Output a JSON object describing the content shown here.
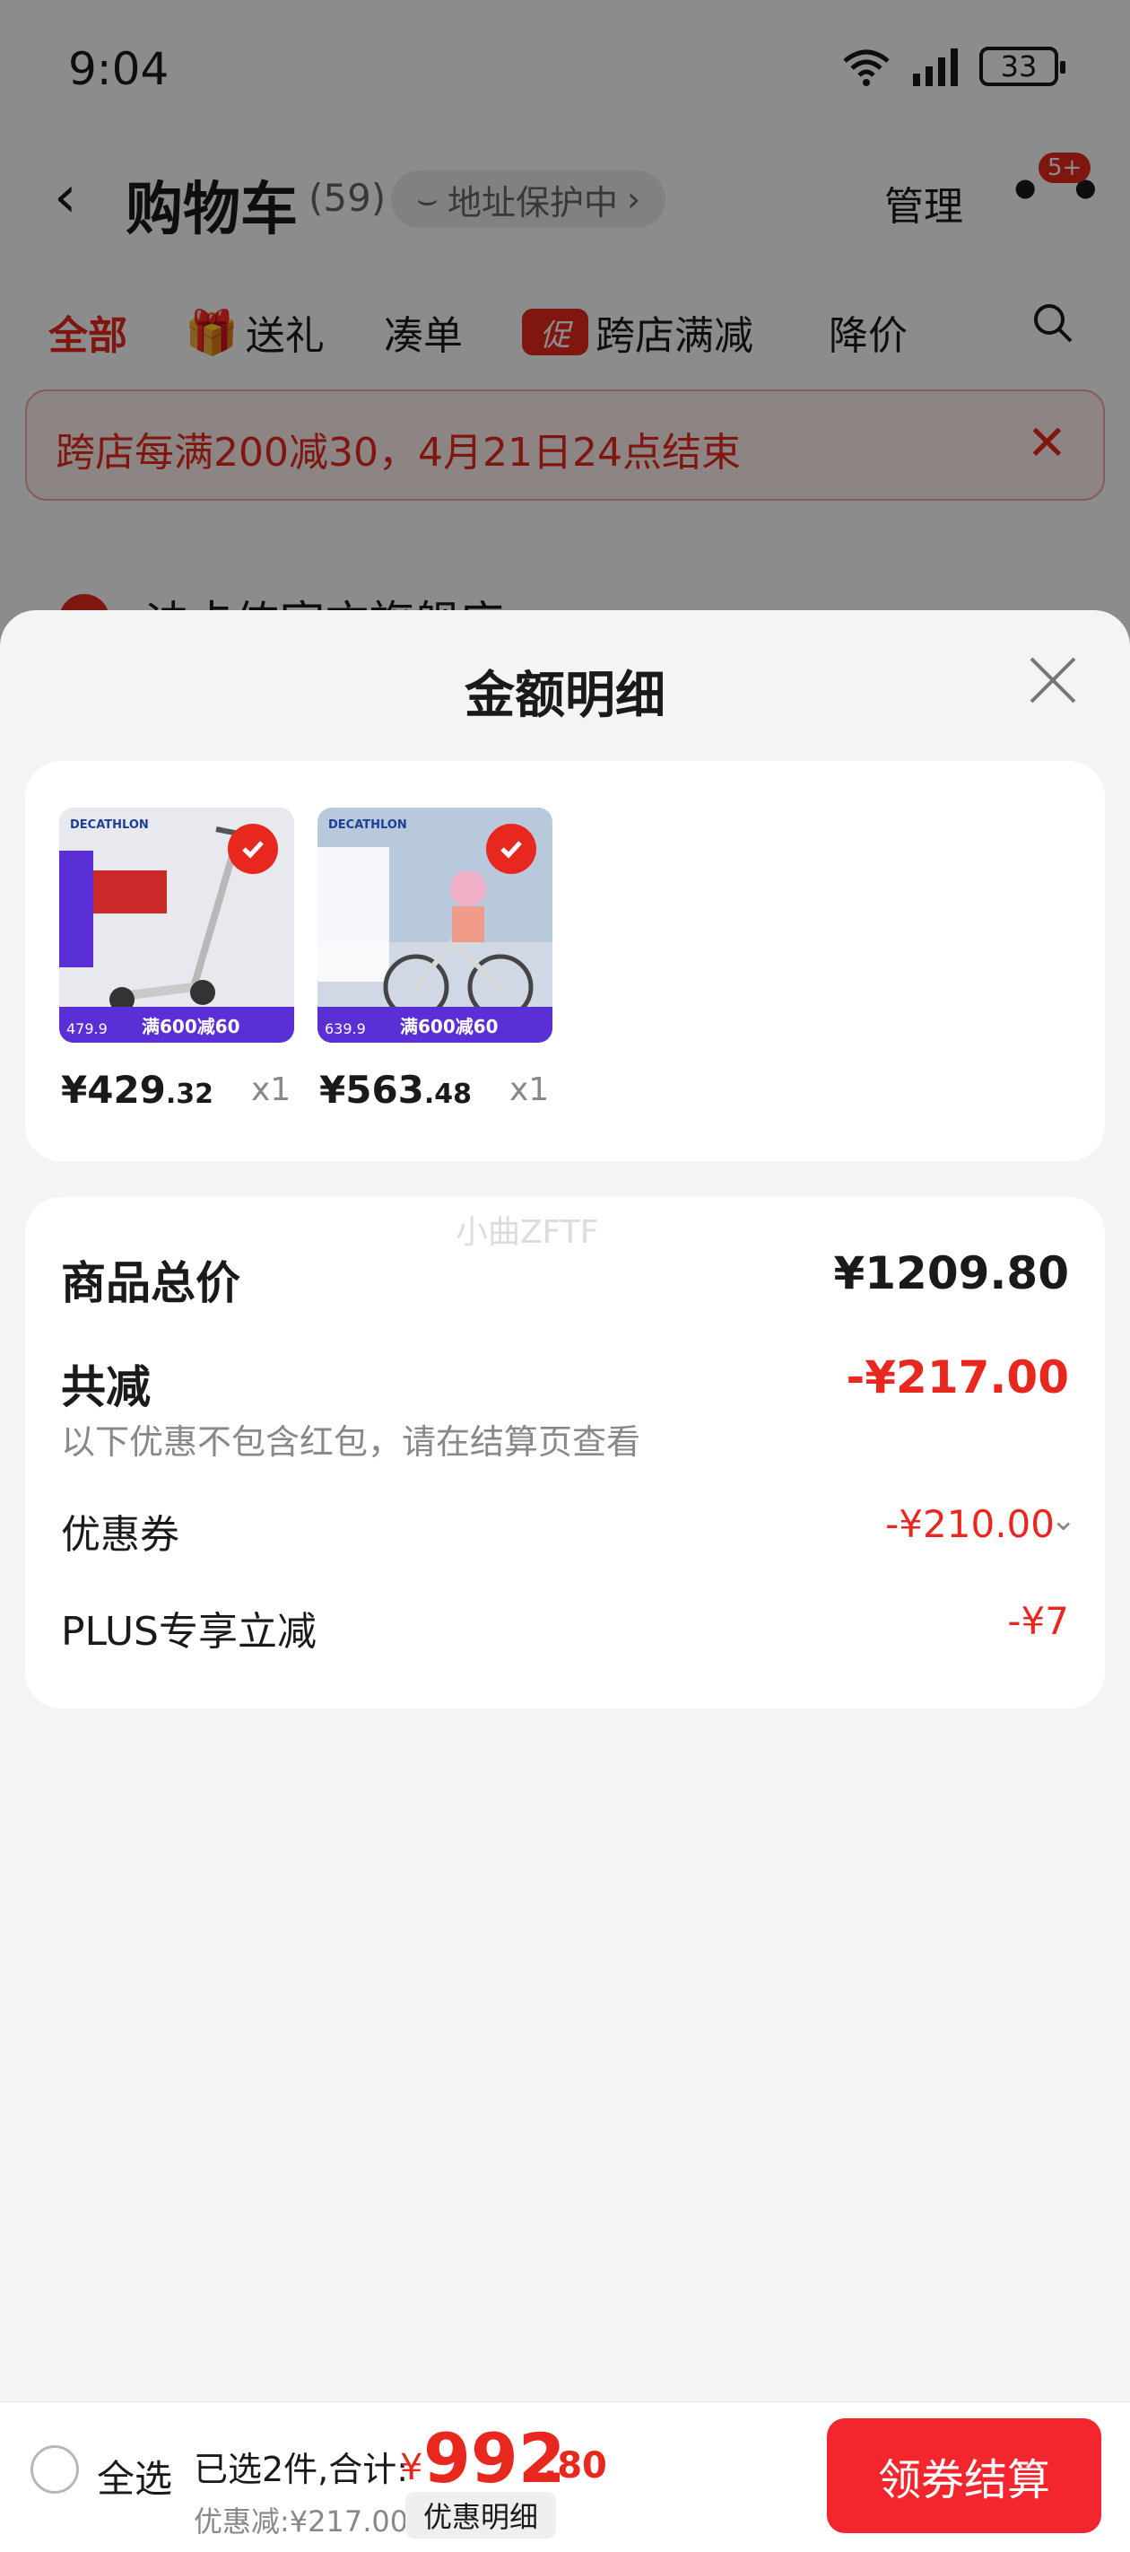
{
  "status_bar": {
    "time": "9:04",
    "battery": "33"
  },
  "header": {
    "title": "购物车",
    "count": "(59)",
    "address": "地址保护中",
    "manage": "管理",
    "badge": "5+"
  },
  "tabs": [
    {
      "label": "全部",
      "active": true
    },
    {
      "label": "送礼",
      "icon": "gift-icon"
    },
    {
      "label": "凑单"
    },
    {
      "label": "跨店满减",
      "icon_text": "促"
    },
    {
      "label": "降价"
    }
  ],
  "promo_banner": {
    "text": "跨店每满200减30，4月21日24点结束"
  },
  "store": {
    "name": "迪卡侬官方旗舰店"
  },
  "sheet": {
    "title": "金额明细",
    "watermark": "小曲ZFTF",
    "items": [
      {
        "brand": "DECATHLON",
        "band": "满600减60",
        "orig": "479.9",
        "price_int": "¥429",
        "price_dec": ".32",
        "qty": "x1",
        "colors": {
          "bg": "#e7e9ee",
          "accent": "#cc2a2a"
        }
      },
      {
        "brand": "DECATHLON",
        "band": "满600减60",
        "orig": "639.9",
        "price_int": "¥563",
        "price_dec": ".48",
        "qty": "x1",
        "colors": {
          "bg": "#b9c9dc",
          "accent": "#5a2fd6"
        }
      }
    ],
    "summary": {
      "total_label": "商品总价",
      "total_value": "¥1209.80",
      "reduce_label": "共减",
      "reduce_value": "-¥217.00",
      "note": "以下优惠不包含红包，请在结算页查看",
      "coupon_label": "优惠券",
      "coupon_value": "-¥210.00",
      "plus_label": "PLUS专享立减",
      "plus_value": "-¥7"
    }
  },
  "bottom_bar": {
    "select_all": "全选",
    "selected": "已选2件,合计:",
    "total_symbol": "¥",
    "total_int": "992",
    "total_dec": ".80",
    "discount": "优惠减:¥217.00",
    "detail_button": "优惠明细",
    "checkout": "领券结算"
  },
  "colors": {
    "accent": "#e8281e",
    "checkout": "#f2262c",
    "sheet_bg": "#f4f4f4"
  }
}
